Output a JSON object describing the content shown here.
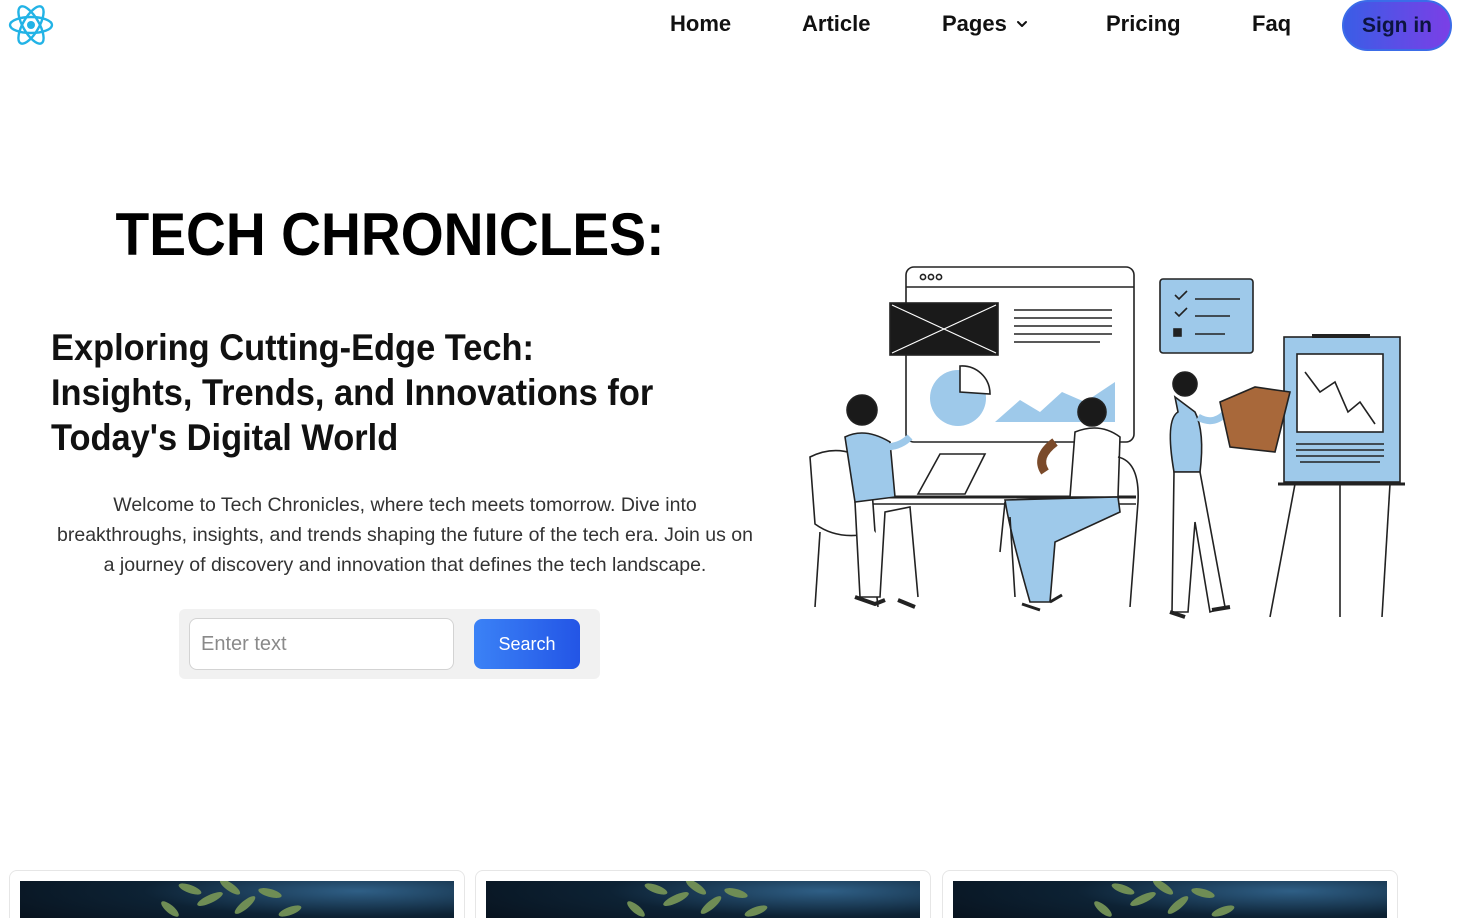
{
  "nav": {
    "logo_icon": "react-atom-icon",
    "links": [
      "Home",
      "Article",
      "Pages",
      "Pricing",
      "Faq"
    ],
    "signin_label": "Sign in",
    "accent_gradient": [
      "#3a5de6",
      "#7b3fe6"
    ]
  },
  "hero": {
    "title": "TECH CHRONICLES:",
    "subtitle": "Exploring Cutting-Edge Tech: Insights, Trends, and Innovations for Today's Digital World",
    "description": "Welcome to Tech Chronicles, where tech meets tomorrow. Dive into breakthroughs, insights, and trends shaping the future of the tech era. Join us on a journey of discovery and innovation that defines the tech landscape.",
    "illustration": "team-meeting-illustration"
  },
  "search": {
    "placeholder": "Enter text",
    "value": "",
    "button_label": "Search",
    "button_color": "#2f6cf0"
  },
  "cards": [
    {
      "image": "plant-leaves-dark-image"
    },
    {
      "image": "plant-leaves-dark-image"
    },
    {
      "image": "plant-leaves-dark-image"
    }
  ]
}
